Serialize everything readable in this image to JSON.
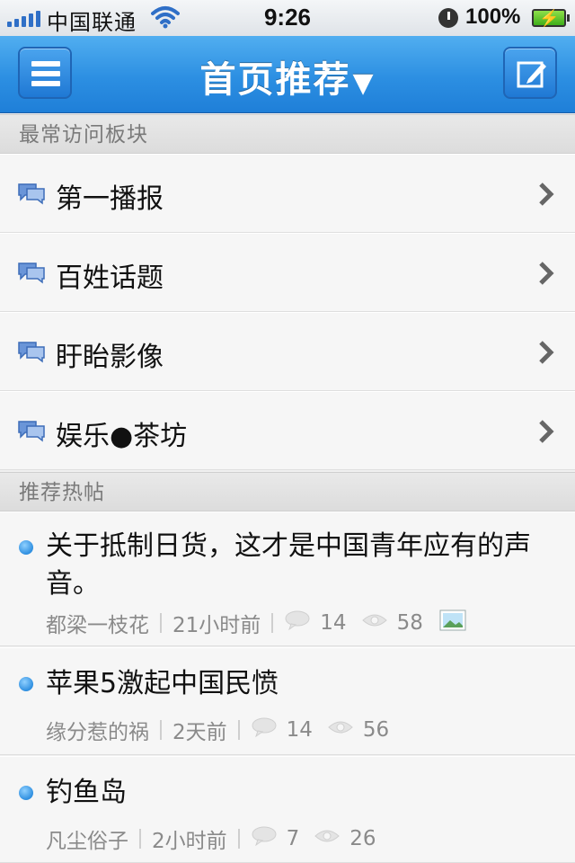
{
  "status_bar": {
    "carrier": "中国联通",
    "time": "9:26",
    "battery": "100%"
  },
  "nav": {
    "title": "首页推荐",
    "title_arrow": "▼"
  },
  "sections": {
    "frequent": "最常访问板块",
    "hot": "推荐热帖"
  },
  "boards": [
    {
      "label": "第一播报"
    },
    {
      "label": "百姓话题"
    },
    {
      "label": "盱眙影像"
    },
    {
      "label": "娱乐●茶坊"
    }
  ],
  "posts": [
    {
      "title": "关于抵制日货，这才是中国青年应有的声音。",
      "author": "都梁一枝花",
      "time": "21小时前",
      "comments": "14",
      "views": "58",
      "has_image": true
    },
    {
      "title": "苹果5激起中国民愤",
      "author": "缘分惹的祸",
      "time": "2天前",
      "comments": "14",
      "views": "56",
      "has_image": false
    },
    {
      "title": "钓鱼岛",
      "author": "凡尘俗子",
      "time": "2小时前",
      "comments": "7",
      "views": "26",
      "has_image": false
    }
  ],
  "colors": {
    "accent": "#2c8fe2",
    "dot": "#2f8fe0"
  },
  "icons": [
    "signal-icon",
    "wifi-icon",
    "alarm-icon",
    "battery-icon",
    "menu-icon",
    "compose-icon",
    "chat-icon",
    "chevron-right-icon",
    "comment-icon",
    "eye-icon",
    "image-icon"
  ]
}
